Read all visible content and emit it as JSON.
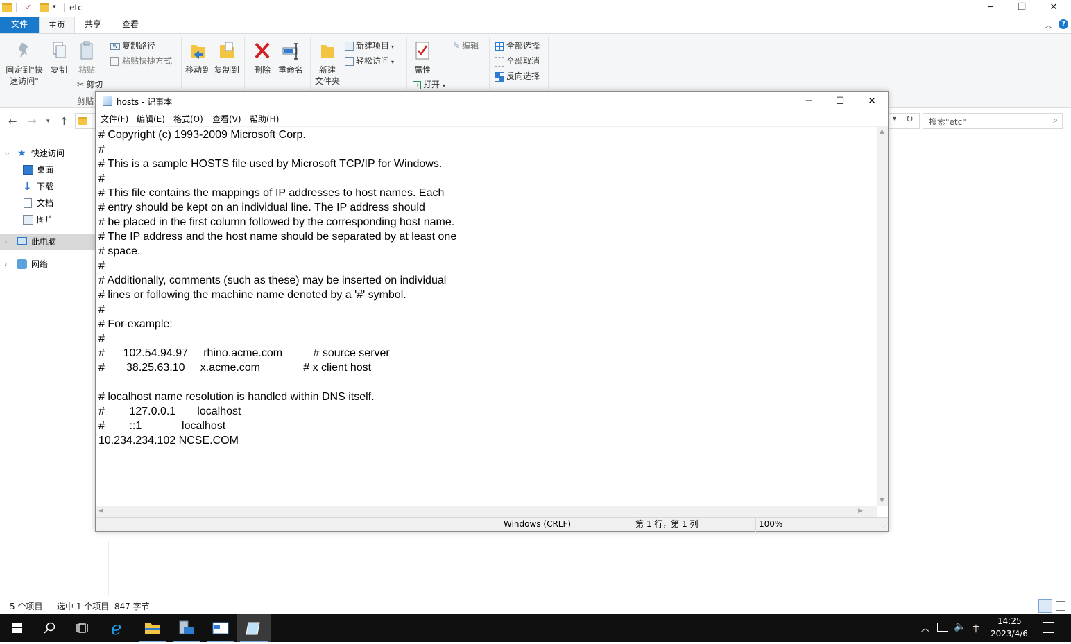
{
  "explorer": {
    "title": "etc",
    "ribbon_tabs": [
      "文件",
      "主页",
      "共享",
      "查看"
    ],
    "ribbon": {
      "pin_label": "固定到\"快速访问\"",
      "copy_label": "复制",
      "paste_label": "粘贴",
      "copy_path_label": "复制路径",
      "paste_shortcut_label": "粘贴快捷方式",
      "cut_label": "剪切",
      "clipboard_group": "剪贴",
      "move_to_label": "移动到",
      "copy_to_label": "复制到",
      "delete_label": "删除",
      "rename_label": "重命名",
      "new_folder_label_1": "新建",
      "new_folder_label_2": "文件夹",
      "new_item_label": "新建项目",
      "easy_access_label": "轻松访问",
      "properties_label": "属性",
      "open_label": "打开",
      "edit_label": "编辑",
      "select_all_label": "全部选择",
      "select_none_label": "全部取消",
      "invert_selection_label": "反向选择"
    },
    "search_placeholder": "搜索\"etc\"",
    "nav": {
      "quick_access": "快速访问",
      "desktop": "桌面",
      "downloads": "下载",
      "documents": "文档",
      "pictures": "图片",
      "this_pc": "此电脑",
      "network": "网络"
    },
    "status": {
      "item_count": "5 个项目",
      "selected": "选中 1 个项目  847 字节"
    }
  },
  "notepad": {
    "title": "hosts - 记事本",
    "menu": [
      "文件(F)",
      "编辑(E)",
      "格式(O)",
      "查看(V)",
      "帮助(H)"
    ],
    "content": "# Copyright (c) 1993-2009 Microsoft Corp.\n#\n# This is a sample HOSTS file used by Microsoft TCP/IP for Windows.\n#\n# This file contains the mappings of IP addresses to host names. Each\n# entry should be kept on an individual line. The IP address should\n# be placed in the first column followed by the corresponding host name.\n# The IP address and the host name should be separated by at least one\n# space.\n#\n# Additionally, comments (such as these) may be inserted on individual\n# lines or following the machine name denoted by a '#' symbol.\n#\n# For example:\n#\n#      102.54.94.97     rhino.acme.com          # source server\n#       38.25.63.10     x.acme.com              # x client host\n\n# localhost name resolution is handled within DNS itself.\n#\t127.0.0.1       localhost\n#\t::1             localhost\n10.234.234.102 NCSE.COM",
    "status": {
      "line_ending": "Windows (CRLF)",
      "position": "第 1 行，第 1 列",
      "zoom": "100%"
    }
  },
  "taskbar": {
    "time": "14:25",
    "date": "2023/4/6",
    "ime": "中"
  }
}
